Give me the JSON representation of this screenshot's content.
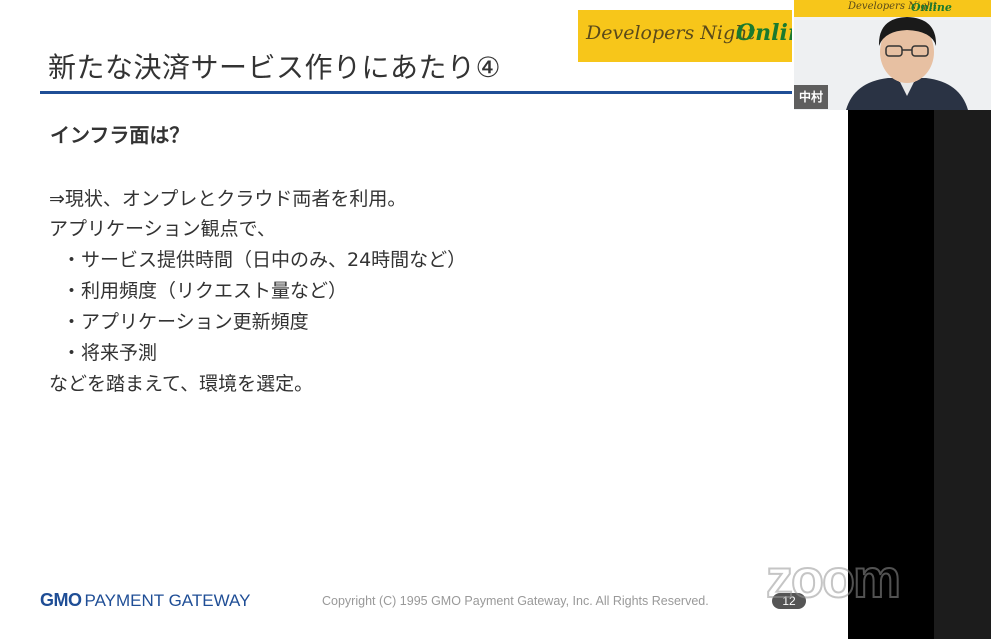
{
  "slide": {
    "title": "新たな決済サービス作りにあたり④",
    "event_banner": {
      "part1": "Developers Night",
      "part2": "Online"
    },
    "section_heading": "インフラ面は？",
    "body_lines": [
      "⇒現状、オンプレとクラウド両者を利用。",
      "アプリケーション観点で、",
      "・サービス提供時間（日中のみ、24時間など）",
      "・利用頻度（リクエスト量など）",
      "・アプリケーション更新頻度",
      "・将来予測",
      "などを踏まえて、環境を選定。"
    ],
    "footer": {
      "logo_gmo": "GMO",
      "logo_rest": "PAYMENT GATEWAY",
      "copyright": "Copyright (C) 1995 GMO Payment Gateway, Inc. All Rights Reserved.",
      "page_number": "12"
    }
  },
  "zoom_watermark": "zoom",
  "video": {
    "participant_name": "中村",
    "banner": {
      "part1": "Developers Night",
      "part2": "Online"
    }
  },
  "colors": {
    "accent": "#1f4e96",
    "banner": "#f7c61a",
    "online_green": "#1a7a2e"
  }
}
